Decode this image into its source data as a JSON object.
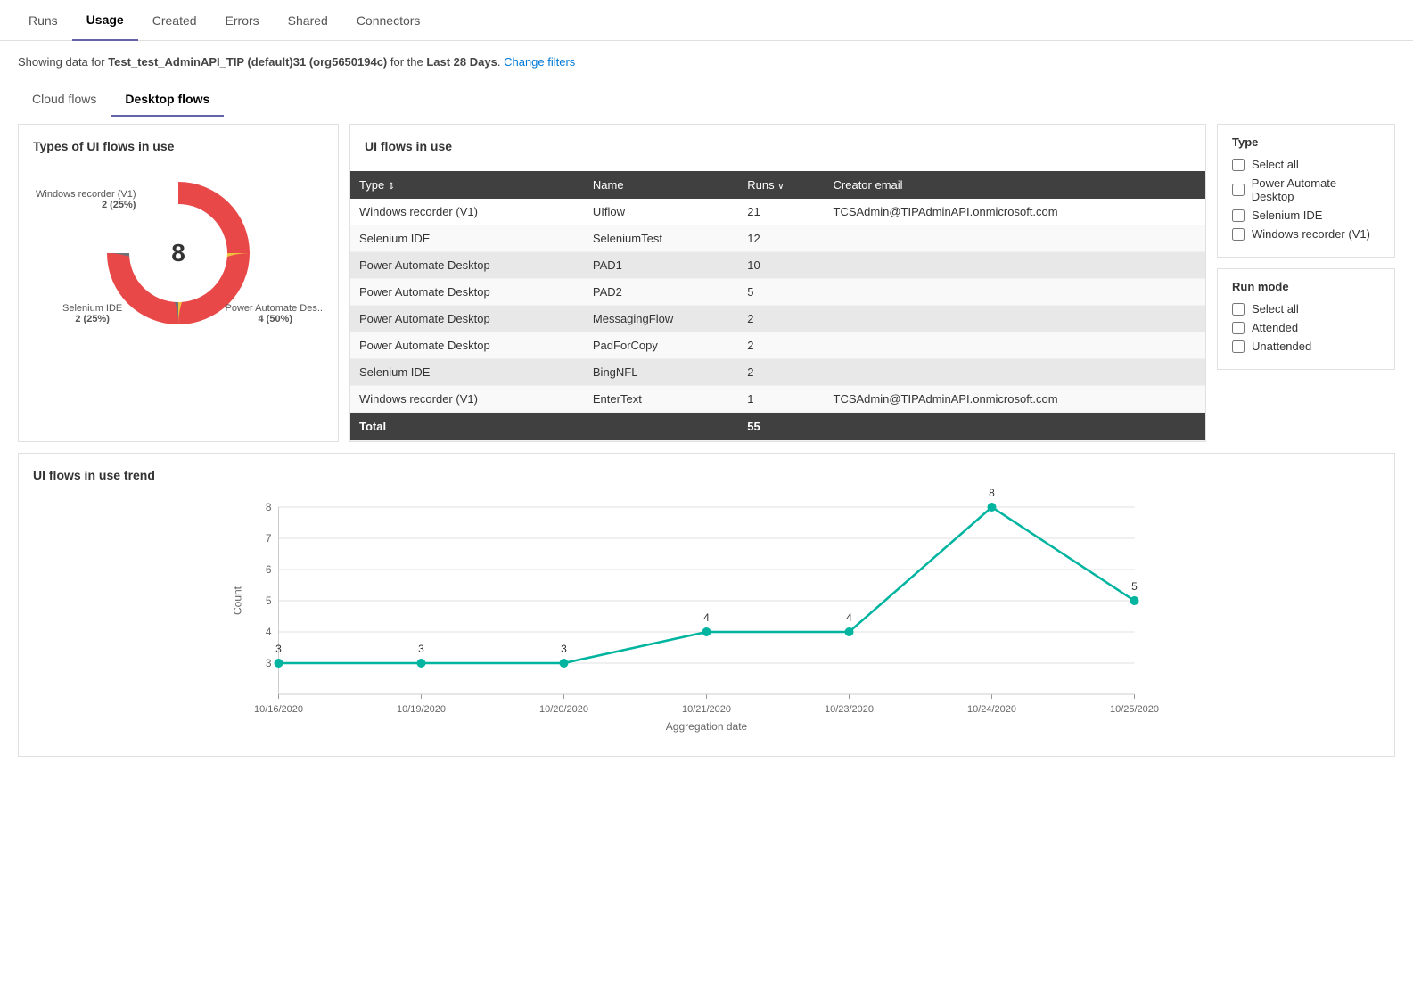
{
  "nav": {
    "items": [
      {
        "label": "Runs",
        "active": false
      },
      {
        "label": "Usage",
        "active": true
      },
      {
        "label": "Created",
        "active": false
      },
      {
        "label": "Errors",
        "active": false
      },
      {
        "label": "Shared",
        "active": false
      },
      {
        "label": "Connectors",
        "active": false
      }
    ]
  },
  "info_bar": {
    "prefix": "Showing data for ",
    "org": "Test_test_AdminAPI_TIP (default)31 (org5650194c)",
    "middle": " for the ",
    "period": "Last 28 Days",
    "suffix": ".",
    "link": "Change filters"
  },
  "flow_tabs": [
    {
      "label": "Cloud flows",
      "active": false
    },
    {
      "label": "Desktop flows",
      "active": true
    }
  ],
  "donut_card": {
    "title": "Types of UI flows in use",
    "center_value": "8",
    "segments": [
      {
        "label": "Power Automate Des...",
        "sub": "4 (50%)",
        "color": "#e84848",
        "percent": 50
      },
      {
        "label": "Windows recorder (V1)",
        "sub": "2 (25%)",
        "color": "#6d7278",
        "percent": 25
      },
      {
        "label": "Selenium IDE",
        "sub": "2 (25%)",
        "color": "#f0c040",
        "percent": 25
      }
    ]
  },
  "table_card": {
    "title": "UI flows in use",
    "columns": [
      "Type",
      "Name",
      "Runs",
      "Creator email"
    ],
    "rows": [
      {
        "type": "Windows recorder (V1)",
        "name": "UIflow",
        "runs": "21",
        "email": "TCSAdmin@TIPAdminAPI.onmicrosoft.com",
        "highlighted": false
      },
      {
        "type": "Selenium IDE",
        "name": "SeleniumTest",
        "runs": "12",
        "email": "",
        "highlighted": false
      },
      {
        "type": "Power Automate Desktop",
        "name": "PAD1",
        "runs": "10",
        "email": "",
        "highlighted": true
      },
      {
        "type": "Power Automate Desktop",
        "name": "PAD2",
        "runs": "5",
        "email": "",
        "highlighted": false
      },
      {
        "type": "Power Automate Desktop",
        "name": "MessagingFlow",
        "runs": "2",
        "email": "",
        "highlighted": true
      },
      {
        "type": "Power Automate Desktop",
        "name": "PadForCopy",
        "runs": "2",
        "email": "",
        "highlighted": false
      },
      {
        "type": "Selenium IDE",
        "name": "BingNFL",
        "runs": "2",
        "email": "",
        "highlighted": true
      },
      {
        "type": "Windows recorder (V1)",
        "name": "EnterText",
        "runs": "1",
        "email": "TCSAdmin@TIPAdminAPI.onmicrosoft.com",
        "highlighted": false
      }
    ],
    "total_label": "Total",
    "total_value": "55"
  },
  "type_filter": {
    "title": "Type",
    "items": [
      {
        "label": "Select all",
        "checked": false
      },
      {
        "label": "Power Automate Desktop",
        "checked": false
      },
      {
        "label": "Selenium IDE",
        "checked": false
      },
      {
        "label": "Windows recorder (V1)",
        "checked": false
      }
    ]
  },
  "run_mode_filter": {
    "title": "Run mode",
    "items": [
      {
        "label": "Select all",
        "checked": false
      },
      {
        "label": "Attended",
        "checked": false
      },
      {
        "label": "Unattended",
        "checked": false
      }
    ]
  },
  "trend_card": {
    "title": "UI flows in use trend",
    "y_label": "Count",
    "x_label": "Aggregation date",
    "y_max": 8,
    "y_min": 3,
    "data_points": [
      {
        "date": "10/16/2020",
        "value": 3
      },
      {
        "date": "10/19/2020",
        "value": 3
      },
      {
        "date": "10/20/2020",
        "value": 3
      },
      {
        "date": "10/21/2020",
        "value": 4
      },
      {
        "date": "10/23/2020",
        "value": 4
      },
      {
        "date": "10/24/2020",
        "value": 8
      },
      {
        "date": "10/25/2020",
        "value": 5
      }
    ],
    "line_color": "#00b4a0"
  }
}
